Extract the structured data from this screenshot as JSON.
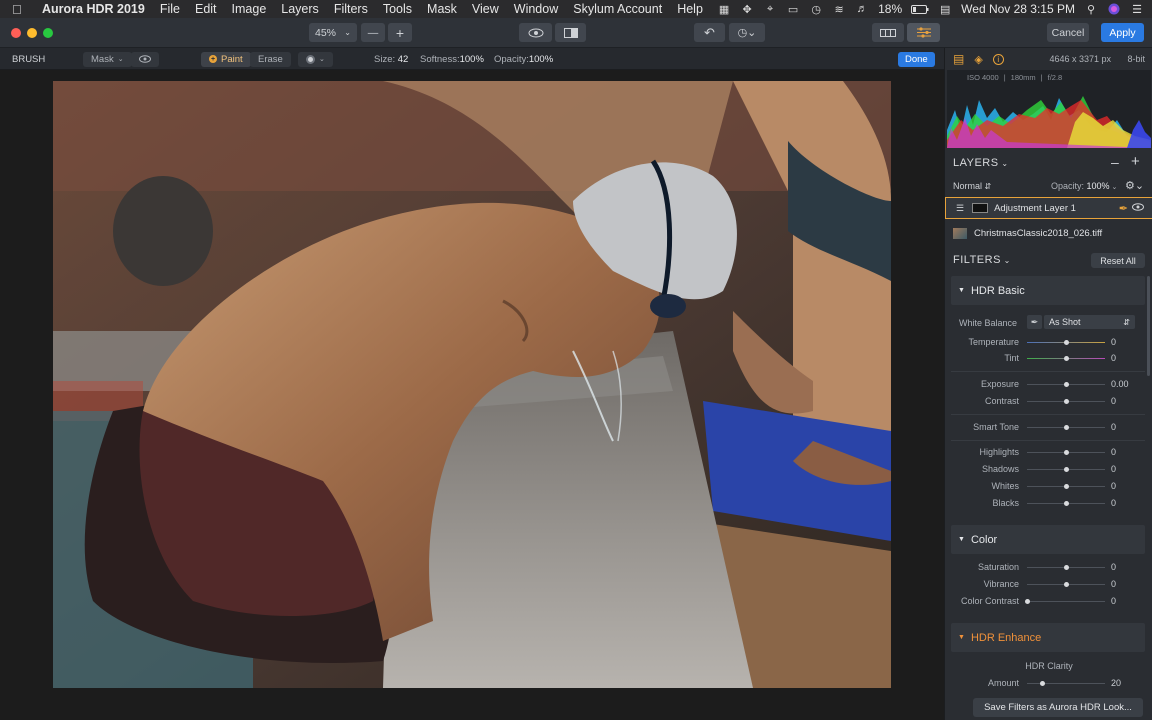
{
  "menubar": {
    "app_name": "Aurora HDR 2019",
    "menus": [
      "File",
      "Edit",
      "Image",
      "Layers",
      "Filters",
      "Tools",
      "Mask",
      "View",
      "Window",
      "Skylum Account",
      "Help"
    ],
    "battery": "18%",
    "clock": "Wed Nov 28  3:15 PM"
  },
  "toolbar": {
    "zoom": "45%",
    "zoom_out": "—",
    "zoom_in": "+",
    "cancel_label": "Cancel",
    "apply_label": "Apply"
  },
  "subbar": {
    "tool_name": "BRUSH",
    "mask_label": "Mask",
    "paint_label": "Paint",
    "erase_label": "Erase",
    "size_label": "Size:",
    "size_value": "42",
    "softness_label": "Softness:",
    "softness_value": "100%",
    "opacity_label": "Opacity:",
    "opacity_value": "100%",
    "done_label": "Done"
  },
  "panel": {
    "image_size": "4646 x 3371 px",
    "bit_depth": "8-bit",
    "exif": [
      "ISO 4000",
      "180mm",
      "f/2.8"
    ],
    "layers_title": "LAYERS",
    "blend_mode": "Normal",
    "opacity_label": "Opacity:",
    "opacity_value": "100%",
    "layers": [
      {
        "name": "Adjustment Layer 1"
      },
      {
        "name": "ChristmasClassic2018_026.tiff"
      }
    ],
    "filters_title": "FILTERS",
    "reset_all": "Reset All",
    "save_filters": "Save Filters as Aurora HDR Look..."
  },
  "filters": {
    "hdr_basic": {
      "title": "HDR Basic",
      "white_balance_label": "White Balance",
      "white_balance_value": "As Shot",
      "temperature": {
        "label": "Temperature",
        "value": "0",
        "pos": 0.5
      },
      "tint": {
        "label": "Tint",
        "value": "0",
        "pos": 0.5
      },
      "exposure": {
        "label": "Exposure",
        "value": "0.00",
        "pos": 0.5
      },
      "contrast": {
        "label": "Contrast",
        "value": "0",
        "pos": 0.5
      },
      "smart_tone": {
        "label": "Smart Tone",
        "value": "0",
        "pos": 0.5
      },
      "highlights": {
        "label": "Highlights",
        "value": "0",
        "pos": 0.5
      },
      "shadows": {
        "label": "Shadows",
        "value": "0",
        "pos": 0.5
      },
      "whites": {
        "label": "Whites",
        "value": "0",
        "pos": 0.5
      },
      "blacks": {
        "label": "Blacks",
        "value": "0",
        "pos": 0.5
      }
    },
    "color": {
      "title": "Color",
      "saturation": {
        "label": "Saturation",
        "value": "0",
        "pos": 0.5
      },
      "vibrance": {
        "label": "Vibrance",
        "value": "0",
        "pos": 0.5
      },
      "color_contrast": {
        "label": "Color Contrast",
        "value": "0",
        "pos": 0.0
      }
    },
    "hdr_enhance": {
      "title": "HDR Enhance",
      "hdr_clarity": "HDR Clarity",
      "amount": {
        "label": "Amount",
        "value": "20",
        "pos": 0.2
      }
    }
  },
  "colors": {
    "accent_blue": "#2a7ae2",
    "hdr_enhance_orange": "#f0913a",
    "layer_highlight": "#e8a33a"
  }
}
